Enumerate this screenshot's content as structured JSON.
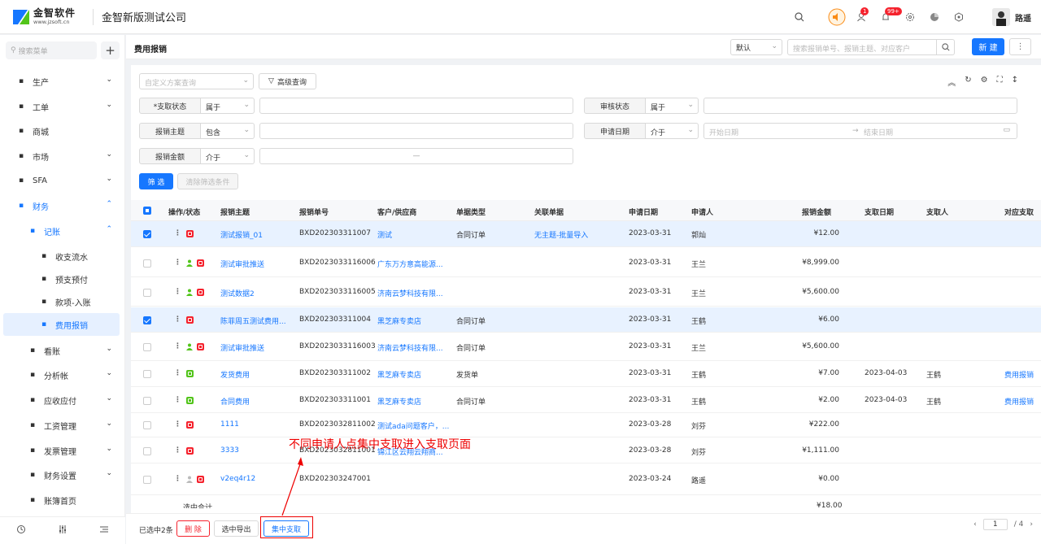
{
  "brand": {
    "logo_title": "金智软件",
    "logo_sub": "www.jzsoft.cn",
    "company": "金智新版测试公司"
  },
  "topbar": {
    "badge_msg": "1",
    "badge_notice": "99+",
    "username": "路遥"
  },
  "sidebar": {
    "search_placeholder": "搜索菜单",
    "items": [
      {
        "label": "生产",
        "icon": "factory-icon"
      },
      {
        "label": "工单",
        "icon": "ticket-icon"
      },
      {
        "label": "商城",
        "icon": "shop-icon"
      },
      {
        "label": "市场",
        "icon": "market-icon"
      },
      {
        "label": "SFA",
        "icon": "sfa-icon"
      },
      {
        "label": "财务",
        "icon": "finance-icon"
      },
      {
        "label": "记账",
        "icon": "ledger-icon"
      },
      {
        "label": "收支流水",
        "icon": "flow-icon"
      },
      {
        "label": "预支预付",
        "icon": "advance-icon"
      },
      {
        "label": "款项-入账",
        "icon": "receipt-icon"
      },
      {
        "label": "费用报销",
        "icon": "expense-icon"
      },
      {
        "label": "看账",
        "icon": "view-icon"
      },
      {
        "label": "分析帐",
        "icon": "analysis-icon"
      },
      {
        "label": "应收应付",
        "icon": "payable-icon"
      },
      {
        "label": "工资管理",
        "icon": "salary-icon"
      },
      {
        "label": "发票管理",
        "icon": "invoice-icon"
      },
      {
        "label": "财务设置",
        "icon": "settings-icon"
      },
      {
        "label": "账簿首页",
        "icon": "book-icon"
      }
    ]
  },
  "header": {
    "title": "费用报销",
    "view_select": "默认",
    "search_placeholder": "搜索报销单号、报销主题、对应客户",
    "new_label": "新 建"
  },
  "filters": {
    "scheme_placeholder": "自定义方案查询",
    "advanced_label": "高级查询",
    "pay_status": {
      "label": "*支取状态",
      "op": "属于"
    },
    "audit_status": {
      "label": "审核状态",
      "op": "属于"
    },
    "subject": {
      "label": "报销主题",
      "op": "包含"
    },
    "apply_date": {
      "label": "申请日期",
      "op": "介于",
      "start": "开始日期",
      "arrow": "→",
      "end": "结束日期"
    },
    "amount": {
      "label": "报销金额",
      "op": "介于",
      "sep": "—"
    },
    "filter_btn": "筛 选",
    "clear_btn": "清除筛选条件"
  },
  "table": {
    "headers": [
      "操作/状态",
      "报销主题",
      "报销单号",
      "客户/供应商",
      "单据类型",
      "关联单据",
      "申请日期",
      "申请人",
      "报销金额",
      "支取日期",
      "支取人",
      "对应支取"
    ],
    "rows": [
      {
        "sel": true,
        "user": false,
        "status": "red",
        "subject": "测试报销_01",
        "no": "BXD202303311007",
        "cust": "测试",
        "type": "合同订单",
        "rel": "无主题-批量导入",
        "date": "2023-03-31",
        "applicant": "郭灿",
        "amount": "¥12.00",
        "pdate": "",
        "payer": "",
        "link": ""
      },
      {
        "sel": false,
        "user": true,
        "status": "red",
        "subject": "测试审批推送",
        "no": "BXD2023033116006",
        "cust": "广东万方意高能源...",
        "type": "",
        "rel": "",
        "date": "2023-03-31",
        "applicant": "王兰",
        "amount": "¥8,999.00",
        "pdate": "",
        "payer": "",
        "link": ""
      },
      {
        "sel": false,
        "user": true,
        "status": "red",
        "subject": "测试数据2",
        "no": "BXD2023033116005",
        "cust": "济南云梦科技有限...",
        "type": "",
        "rel": "",
        "date": "2023-03-31",
        "applicant": "王兰",
        "amount": "¥5,600.00",
        "pdate": "",
        "payer": "",
        "link": ""
      },
      {
        "sel": true,
        "user": false,
        "status": "red",
        "subject": "陈菲周五测试费用...",
        "no": "BXD202303311004",
        "cust": "黑芝麻专卖店",
        "type": "合同订单",
        "rel": "",
        "date": "2023-03-31",
        "applicant": "王鹤",
        "amount": "¥6.00",
        "pdate": "",
        "payer": "",
        "link": ""
      },
      {
        "sel": false,
        "user": true,
        "status": "red",
        "subject": "测试审批推送",
        "no": "BXD2023033116003",
        "cust": "济南云梦科技有限...",
        "type": "合同订单",
        "rel": "",
        "date": "2023-03-31",
        "applicant": "王兰",
        "amount": "¥5,600.00",
        "pdate": "",
        "payer": "",
        "link": ""
      },
      {
        "sel": false,
        "user": false,
        "status": "green",
        "subject": "发货费用",
        "no": "BXD202303311002",
        "cust": "黑芝麻专卖店",
        "type": "发货单",
        "rel": "",
        "date": "2023-03-31",
        "applicant": "王鹤",
        "amount": "¥7.00",
        "pdate": "2023-04-03",
        "payer": "王鹤",
        "link": "费用报销"
      },
      {
        "sel": false,
        "user": false,
        "status": "green",
        "subject": "合同费用",
        "no": "BXD202303311001",
        "cust": "黑芝麻专卖店",
        "type": "合同订单",
        "rel": "",
        "date": "2023-03-31",
        "applicant": "王鹤",
        "amount": "¥2.00",
        "pdate": "2023-04-03",
        "payer": "王鹤",
        "link": "费用报销"
      },
      {
        "sel": false,
        "user": false,
        "status": "red",
        "subject": "1111",
        "no": "BXD2023032811002",
        "cust": "测试ada问题客户，...",
        "type": "",
        "rel": "",
        "date": "2023-03-28",
        "applicant": "刘芬",
        "amount": "¥222.00",
        "pdate": "",
        "payer": "",
        "link": ""
      },
      {
        "sel": false,
        "user": false,
        "status": "red",
        "subject": "3333",
        "no": "BXD2023032811001",
        "cust": "锦江区云翔云翔商...",
        "type": "",
        "rel": "",
        "date": "2023-03-28",
        "applicant": "刘芬",
        "amount": "¥1,111.00",
        "pdate": "",
        "payer": "",
        "link": ""
      },
      {
        "sel": false,
        "user": true,
        "status": "red",
        "subject": "v2eq4r12",
        "no": "BXD202303247001",
        "cust": "",
        "type": "",
        "rel": "",
        "date": "2023-03-24",
        "applicant": "路遥",
        "amount": "¥0.00",
        "pdate": "",
        "payer": "",
        "link": ""
      }
    ],
    "subtotal_label": "选中合计",
    "subtotal_amount": "¥18.00"
  },
  "footer": {
    "selected": "已选中2条",
    "delete": "删 除",
    "export": "选中导出",
    "batch_pay": "集中支取",
    "page_current": "1",
    "page_total": "/ 4"
  },
  "annotation": "不同申请人点集中支取进入支取页面",
  "colors": {
    "primary": "#1677ff",
    "danger": "#f5222d",
    "success": "#52c41a",
    "annotation": "#e00000"
  }
}
